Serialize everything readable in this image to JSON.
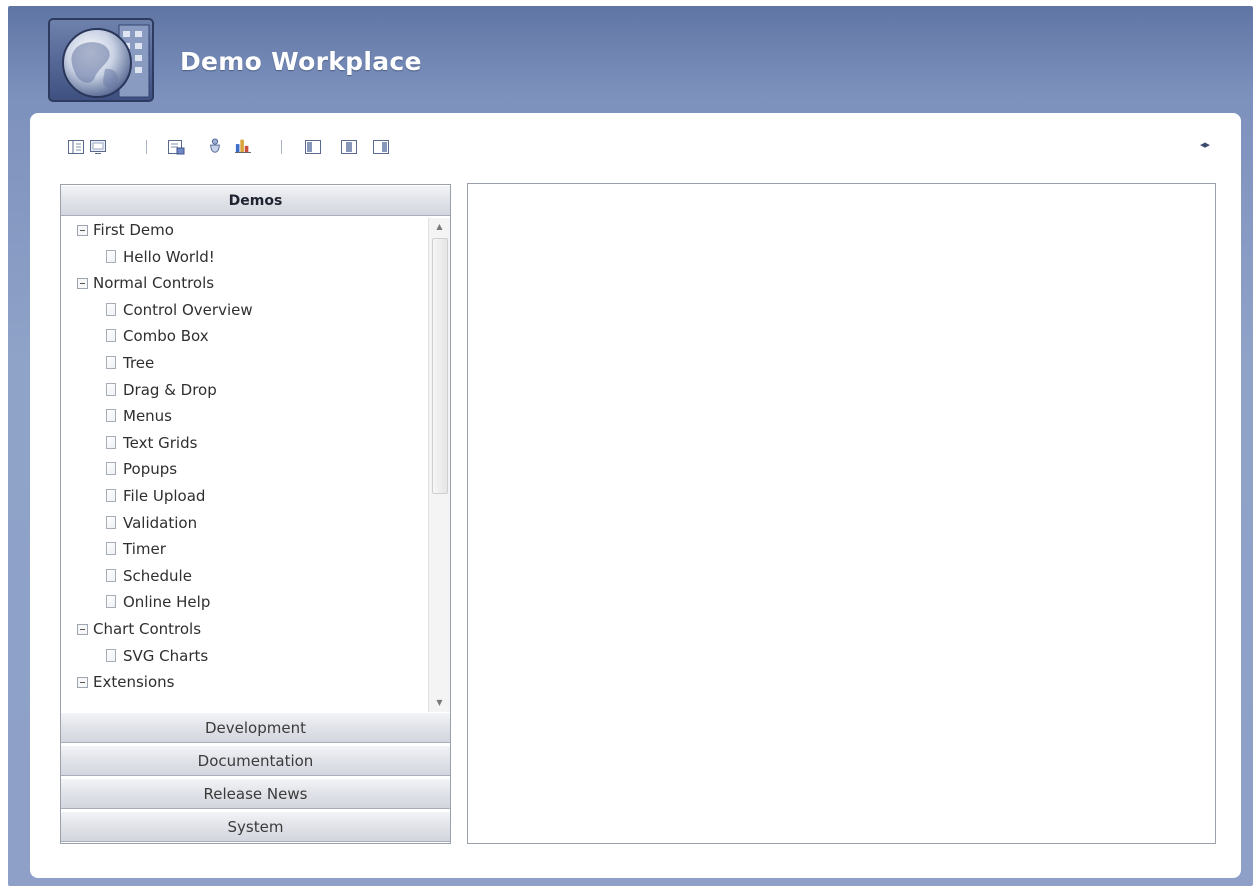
{
  "app": {
    "title": "Demo Workplace",
    "logo_icon": "globe-window-logo-icon"
  },
  "toolbar": {
    "group1": [
      {
        "icon": "outline-view-icon"
      },
      {
        "icon": "monitor-view-icon"
      }
    ],
    "group2": [
      {
        "icon": "document-edit-icon"
      },
      {
        "icon": "shield-icon"
      },
      {
        "icon": "bar-chart-icon"
      }
    ],
    "group3": [
      {
        "icon": "layout-left-icon"
      },
      {
        "icon": "layout-center-icon"
      },
      {
        "icon": "layout-right-icon"
      }
    ],
    "collapse_icon": "collapse-arrows-icon",
    "collapse_glyph": "◂▸"
  },
  "navigation": {
    "active_section": "Demos",
    "tree": [
      {
        "label": "First Demo",
        "type": "folder",
        "expanded": true
      },
      {
        "label": "Hello World!",
        "type": "document"
      },
      {
        "label": "Normal Controls",
        "type": "folder",
        "expanded": true
      },
      {
        "label": "Control Overview",
        "type": "document"
      },
      {
        "label": "Combo Box",
        "type": "document"
      },
      {
        "label": "Tree",
        "type": "document"
      },
      {
        "label": "Drag & Drop",
        "type": "document"
      },
      {
        "label": "Menus",
        "type": "document"
      },
      {
        "label": "Text Grids",
        "type": "document"
      },
      {
        "label": "Popups",
        "type": "document"
      },
      {
        "label": "File Upload",
        "type": "document"
      },
      {
        "label": "Validation",
        "type": "document"
      },
      {
        "label": "Timer",
        "type": "document"
      },
      {
        "label": "Schedule",
        "type": "document"
      },
      {
        "label": "Online Help",
        "type": "document"
      },
      {
        "label": "Chart Controls",
        "type": "folder",
        "expanded": true
      },
      {
        "label": "SVG Charts",
        "type": "document"
      },
      {
        "label": "Extensions",
        "type": "folder",
        "expanded": true
      }
    ],
    "scroll_up_glyph": "▲",
    "scroll_down_glyph": "▼",
    "sections": [
      {
        "label": "Development"
      },
      {
        "label": "Documentation"
      },
      {
        "label": "Release News"
      },
      {
        "label": "System"
      }
    ]
  },
  "colors": {
    "header_gradient_top": "#5f75a3",
    "header_gradient_bottom": "#8ea0c7",
    "panel_background": "#ffffff",
    "border": "#9aa1ad"
  }
}
